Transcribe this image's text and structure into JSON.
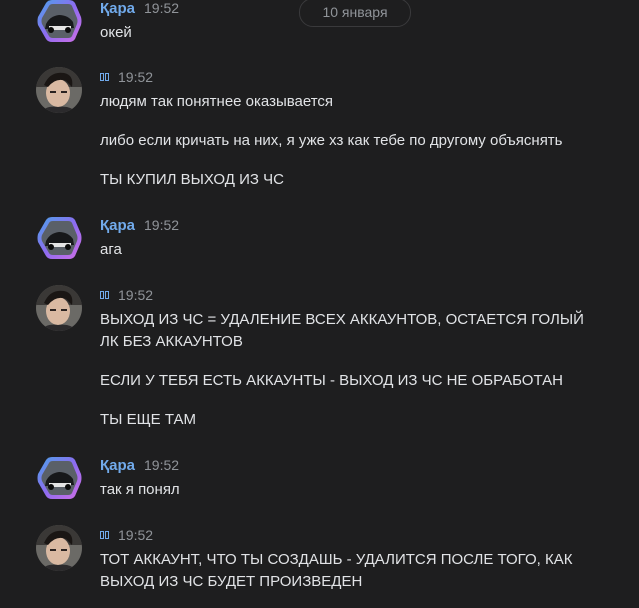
{
  "date_separator": "10 января",
  "colors": {
    "background": "#1e1e1f",
    "author": "#71aaeb",
    "time": "#909499",
    "text": "#e1e3e6"
  },
  "messages": [
    {
      "author": "Қара",
      "author_style": "name",
      "avatar": "car-avatar",
      "time": "19:52",
      "lines": [
        "окей"
      ]
    },
    {
      "author": "",
      "author_style": "glyph-boxes",
      "avatar": "person-avatar",
      "time": "19:52",
      "lines": [
        "людям так понятнее оказывается",
        "либо если кричать на них, я уже хз как тебе по другому объяснять",
        "ТЫ КУПИЛ ВЫХОД ИЗ ЧС"
      ]
    },
    {
      "author": "Қара",
      "author_style": "name",
      "avatar": "car-avatar",
      "time": "19:52",
      "lines": [
        "ага"
      ]
    },
    {
      "author": "",
      "author_style": "glyph-boxes",
      "avatar": "person-avatar",
      "time": "19:52",
      "lines": [
        "ВЫХОД ИЗ ЧС = УДАЛЕНИЕ ВСЕХ АККАУНТОВ, ОСТАЕТСЯ ГОЛЫЙ\nЛК БЕЗ АККАУНТОВ",
        "ЕСЛИ У ТЕБЯ ЕСТЬ АККАУНТЫ - ВЫХОД ИЗ ЧС НЕ ОБРАБОТАН",
        "ТЫ ЕЩЕ ТАМ"
      ]
    },
    {
      "author": "Қара",
      "author_style": "name",
      "avatar": "car-avatar",
      "time": "19:52",
      "lines": [
        "так я понял"
      ]
    },
    {
      "author": "",
      "author_style": "glyph-boxes",
      "avatar": "person-avatar",
      "time": "19:52",
      "lines": [
        "ТОТ АККАУНТ, ЧТО ТЫ СОЗДАШЬ - УДАЛИТСЯ ПОСЛЕ ТОГО, КАК\nВЫХОД ИЗ ЧС БУДЕТ ПРОИЗВЕДЕН"
      ]
    }
  ]
}
